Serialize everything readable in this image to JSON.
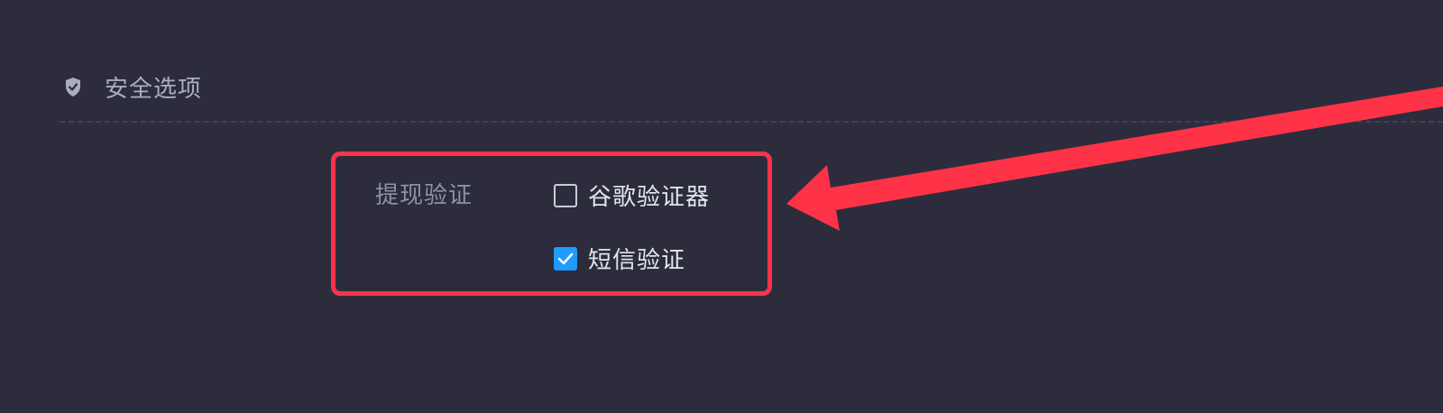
{
  "section": {
    "icon": "shield-check-icon",
    "title": "安全选项"
  },
  "withdraw_verification": {
    "label": "提现验证",
    "options": [
      {
        "label": "谷歌验证器",
        "checked": false
      },
      {
        "label": "短信验证",
        "checked": true
      }
    ]
  },
  "colors": {
    "background": "#2c2c3c",
    "highlight": "#ff3347",
    "checkbox_checked": "#1f9cff"
  }
}
